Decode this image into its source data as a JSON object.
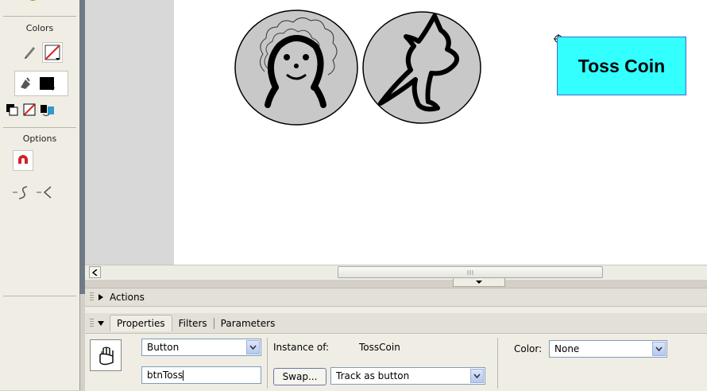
{
  "toolbar": {
    "colors_label": "Colors",
    "options_label": "Options"
  },
  "stage": {
    "button_text": "Toss Coin"
  },
  "panels": {
    "actions_label": "Actions",
    "tabs": [
      {
        "label": "Properties",
        "active": true
      },
      {
        "label": "Filters",
        "active": false
      },
      {
        "label": "Parameters",
        "active": false
      }
    ],
    "symbol_type": "Button",
    "instance_name": "btnToss",
    "instance_of_label": "Instance of:",
    "instance_of_value": "TossCoin",
    "swap_label": "Swap...",
    "track_option": "Track as button",
    "color_label": "Color:",
    "color_value": "None"
  },
  "colors": {
    "button_fill": "#33ffff",
    "coin_fill": "#c8c8c8",
    "splitter": "#6f7a86"
  }
}
